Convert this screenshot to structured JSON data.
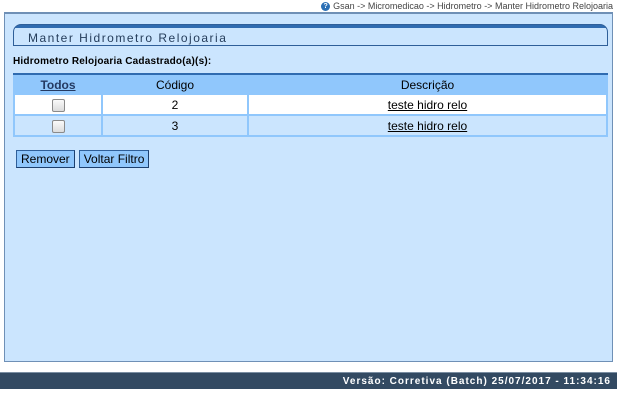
{
  "breadcrumb": {
    "text": "Gsan -> Micromedicao -> Hidrometro -> Manter Hidrometro Relojoaria",
    "icon": "help-icon"
  },
  "panel": {
    "title": "Manter Hidrometro Relojoaria",
    "section_label": "Hidrometro Relojoaria Cadastrado(a)(s):"
  },
  "table": {
    "headers": [
      "Todos",
      "Código",
      "Descrição"
    ],
    "rows": [
      {
        "checked": false,
        "codigo": "2",
        "descricao": "teste hidro relo"
      },
      {
        "checked": false,
        "codigo": "3",
        "descricao": "teste hidro relo"
      }
    ]
  },
  "buttons": {
    "remover": "Remover",
    "voltar": "Voltar Filtro"
  },
  "footer": {
    "version": "Versão: Corretiva (Batch) 25/07/2017 - 11:34:16"
  },
  "colors": {
    "panel_bg": "#cbe5fe",
    "header_bg": "#90c7fc",
    "title_border": "#2f6bb0",
    "footer_bg": "#334a62"
  }
}
